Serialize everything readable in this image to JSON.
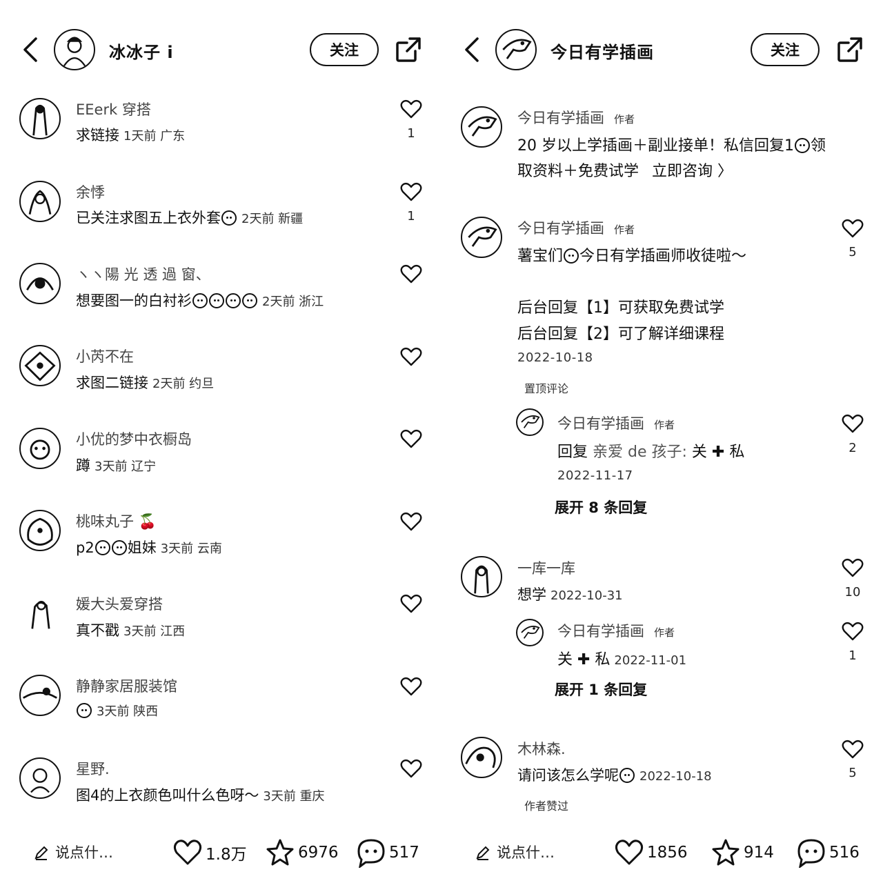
{
  "left": {
    "header": {
      "name": "冰冰子 i",
      "follow": "关注"
    },
    "comments": [
      {
        "name": "EEerk 穿搭",
        "text": "求链接",
        "meta": "1天前 广东",
        "likes": "1"
      },
      {
        "name": "余悸",
        "text": "已关注求图五上衣外套",
        "meta": "2天前 新疆",
        "likes": "1"
      },
      {
        "name": "ヽヽ陽 光 透 過 窗、",
        "text": "想要图一的白衬衫",
        "meta": "2天前 浙江",
        "likes": ""
      },
      {
        "name": "小芮不在",
        "text": "求图二链接",
        "meta": "2天前 约旦",
        "likes": ""
      },
      {
        "name": "小优的梦中衣橱岛",
        "text": "蹲",
        "meta": "3天前 辽宁",
        "likes": ""
      },
      {
        "name": "桃味丸子",
        "text": "p2",
        "text2": "姐妹",
        "meta": "3天前 云南",
        "likes": ""
      },
      {
        "name": "媛大头爱穿搭",
        "text": "真不戳",
        "meta": "3天前 江西",
        "likes": ""
      },
      {
        "name": "静静家居服装馆",
        "text": "",
        "meta": "3天前 陕西",
        "likes": ""
      },
      {
        "name": "星野.",
        "text": "图4的上衣颜色叫什么色呀～",
        "meta": "3天前 重庆",
        "likes": ""
      }
    ],
    "bottom": {
      "say": "说点什…",
      "likes": "1.8万",
      "stars": "6976",
      "comments": "517"
    }
  },
  "right": {
    "header": {
      "name": "今日有学插画",
      "follow": "关注"
    },
    "c1": {
      "name": "今日有学插画",
      "tag": "作者",
      "line1": "20 岁以上学插画＋副业接单！私信回复1",
      "line1b": "领",
      "line2": "取资料＋免费试学",
      "link": "立即咨询 〉"
    },
    "c2": {
      "name": "今日有学插画",
      "tag": "作者",
      "line1": "薯宝们",
      "line1b": "今日有学插画师收徒啦～",
      "likes": "5",
      "line3": "后台回复【1】可获取免费试学",
      "line4": "后台回复【2】可了解详细课程",
      "date": "2022-10-18",
      "pinned": "置顶评论"
    },
    "r2": {
      "name": "今日有学插画",
      "tag": "作者",
      "text": "回复",
      "reply_to": "亲爱 de 孩子:",
      "text2": "关 ✚ 私",
      "likes": "2",
      "date": "2022-11-17",
      "expand": "展开 8 条回复"
    },
    "c3": {
      "name": "一库一库",
      "text": "想学",
      "date": "2022-10-31",
      "likes": "10"
    },
    "r3": {
      "name": "今日有学插画",
      "tag": "作者",
      "text": "关 ✚ 私",
      "date": "2022-11-01",
      "likes": "1",
      "expand": "展开 1 条回复"
    },
    "c4": {
      "name": "木林森.",
      "text": "请问该怎么学呢",
      "date": "2022-10-18",
      "likes": "5",
      "tag2": "作者赞过"
    },
    "bottom": {
      "say": "说点什…",
      "likes": "1856",
      "stars": "914",
      "comments": "516"
    }
  }
}
